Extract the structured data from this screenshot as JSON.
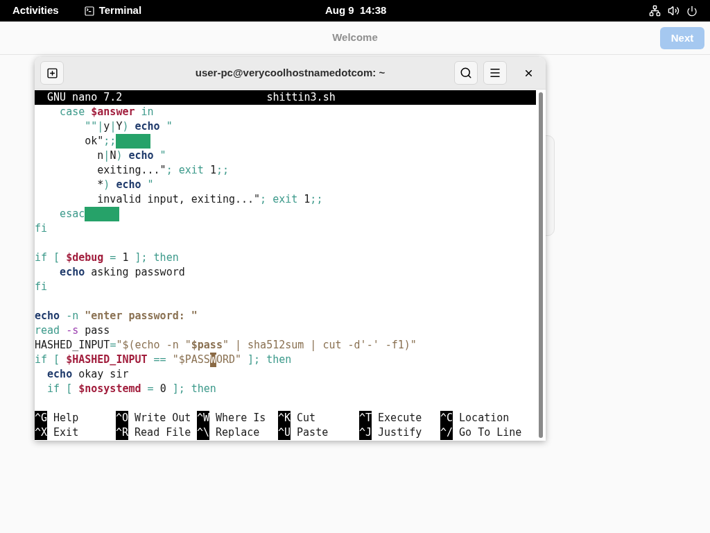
{
  "top_bar": {
    "activities": "Activities",
    "app": "Terminal",
    "clock": "Aug 9  14:38"
  },
  "background_app": {
    "title": "Welcome",
    "next_button": {
      "label": "Next",
      "disabled": true
    }
  },
  "terminal": {
    "title": "user-pc@verycoolhostnamedotcom: ~",
    "nano": {
      "version": "GNU nano 7.2",
      "filename": "shittin3.sh",
      "lines": [
        {
          "kind": "code",
          "segments": [
            {
              "kind": "keyword",
              "text": "    case "
            },
            {
              "kind": "variable",
              "text": "$answer"
            },
            {
              "kind": "keyword",
              "text": " in"
            }
          ]
        },
        {
          "kind": "code",
          "segments": [
            {
              "kind": "keyword",
              "text": "        \"\"|"
            },
            {
              "kind": "plain",
              "text": "y"
            },
            {
              "kind": "keyword",
              "text": "|"
            },
            {
              "kind": "plain",
              "text": "Y"
            },
            {
              "kind": "keyword",
              "text": ") "
            },
            {
              "kind": "command",
              "text": "echo"
            },
            {
              "kind": "keyword",
              "text": " \""
            }
          ]
        },
        {
          "kind": "code",
          "segments": [
            {
              "kind": "plain",
              "text": "        ok\""
            },
            {
              "kind": "keyword",
              "text": ";;"
            },
            {
              "kind": "trailing_space"
            }
          ]
        },
        {
          "kind": "code",
          "segments": [
            {
              "kind": "plain",
              "text": "          n"
            },
            {
              "kind": "keyword",
              "text": "|"
            },
            {
              "kind": "plain",
              "text": "N"
            },
            {
              "kind": "keyword",
              "text": ") "
            },
            {
              "kind": "command",
              "text": "echo"
            },
            {
              "kind": "keyword",
              "text": " \""
            }
          ]
        },
        {
          "kind": "code",
          "segments": [
            {
              "kind": "plain",
              "text": "          exiting...\""
            },
            {
              "kind": "keyword",
              "text": "; exit "
            },
            {
              "kind": "plain",
              "text": "1"
            },
            {
              "kind": "keyword",
              "text": ";;"
            }
          ]
        },
        {
          "kind": "code",
          "segments": [
            {
              "kind": "plain",
              "text": "          *"
            },
            {
              "kind": "keyword",
              "text": ") "
            },
            {
              "kind": "command",
              "text": "echo"
            },
            {
              "kind": "keyword",
              "text": " \""
            }
          ]
        },
        {
          "kind": "code",
          "segments": [
            {
              "kind": "plain",
              "text": "          invalid input, exiting...\""
            },
            {
              "kind": "keyword",
              "text": "; exit "
            },
            {
              "kind": "plain",
              "text": "1"
            },
            {
              "kind": "keyword",
              "text": ";;"
            }
          ]
        },
        {
          "kind": "code",
          "segments": [
            {
              "kind": "keyword",
              "text": "    esac"
            },
            {
              "kind": "trailing_space"
            }
          ]
        },
        {
          "kind": "code",
          "segments": [
            {
              "kind": "keyword",
              "text": "fi"
            }
          ]
        },
        {
          "kind": "blank"
        },
        {
          "kind": "code",
          "segments": [
            {
              "kind": "keyword",
              "text": "if [ "
            },
            {
              "kind": "variable",
              "text": "$debug"
            },
            {
              "kind": "keyword",
              "text": " = "
            },
            {
              "kind": "plain",
              "text": "1"
            },
            {
              "kind": "keyword",
              "text": " ]; then"
            }
          ]
        },
        {
          "kind": "code",
          "segments": [
            {
              "kind": "command",
              "text": "    echo"
            },
            {
              "kind": "plain",
              "text": " asking password"
            }
          ]
        },
        {
          "kind": "code",
          "segments": [
            {
              "kind": "keyword",
              "text": "fi"
            }
          ]
        },
        {
          "kind": "blank"
        },
        {
          "kind": "code",
          "segments": [
            {
              "kind": "command",
              "text": "echo"
            },
            {
              "kind": "keyword",
              "text": " -n "
            },
            {
              "kind": "string_bold",
              "text": "\"enter password: \""
            }
          ]
        },
        {
          "kind": "code",
          "segments": [
            {
              "kind": "keyword",
              "text": "read "
            },
            {
              "kind": "flag",
              "text": "-s"
            },
            {
              "kind": "plain",
              "text": " pass"
            }
          ]
        },
        {
          "kind": "code",
          "segments": [
            {
              "kind": "plain",
              "text": "HASHED_INPUT"
            },
            {
              "kind": "keyword",
              "text": "="
            },
            {
              "kind": "string",
              "text": "\"$(echo -n \""
            },
            {
              "kind": "string_bold",
              "text": "$pass"
            },
            {
              "kind": "string",
              "text": "\" | sha512sum | cut -d'-' -f1)\""
            }
          ]
        },
        {
          "kind": "code",
          "segments": [
            {
              "kind": "keyword",
              "text": "if [ "
            },
            {
              "kind": "variable",
              "text": "$HASHED_INPUT"
            },
            {
              "kind": "keyword",
              "text": " == "
            },
            {
              "kind": "string",
              "text": "\"$PASS"
            },
            {
              "kind": "cursor",
              "text": "W"
            },
            {
              "kind": "string",
              "text": "ORD\""
            },
            {
              "kind": "keyword",
              "text": " ]; then"
            }
          ]
        },
        {
          "kind": "code",
          "segments": [
            {
              "kind": "command",
              "text": "  echo"
            },
            {
              "kind": "plain",
              "text": " okay sir"
            }
          ]
        },
        {
          "kind": "code",
          "segments": [
            {
              "kind": "keyword",
              "text": "  if [ "
            },
            {
              "kind": "variable",
              "text": "$nosystemd"
            },
            {
              "kind": "keyword",
              "text": " = "
            },
            {
              "kind": "plain",
              "text": "0"
            },
            {
              "kind": "keyword",
              "text": " ]; then"
            }
          ]
        },
        {
          "kind": "blank"
        }
      ],
      "shortcuts": [
        [
          {
            "key": "^G",
            "label": "Help"
          },
          {
            "key": "^O",
            "label": "Write Out"
          },
          {
            "key": "^W",
            "label": "Where Is"
          },
          {
            "key": "^K",
            "label": "Cut"
          },
          {
            "key": "^T",
            "label": "Execute"
          },
          {
            "key": "^C",
            "label": "Location"
          }
        ],
        [
          {
            "key": "^X",
            "label": "Exit"
          },
          {
            "key": "^R",
            "label": "Read File"
          },
          {
            "key": "^\\",
            "label": "Replace"
          },
          {
            "key": "^U",
            "label": "Paste"
          },
          {
            "key": "^J",
            "label": "Justify"
          },
          {
            "key": "^/",
            "label": "Go To Line"
          }
        ]
      ]
    }
  }
}
